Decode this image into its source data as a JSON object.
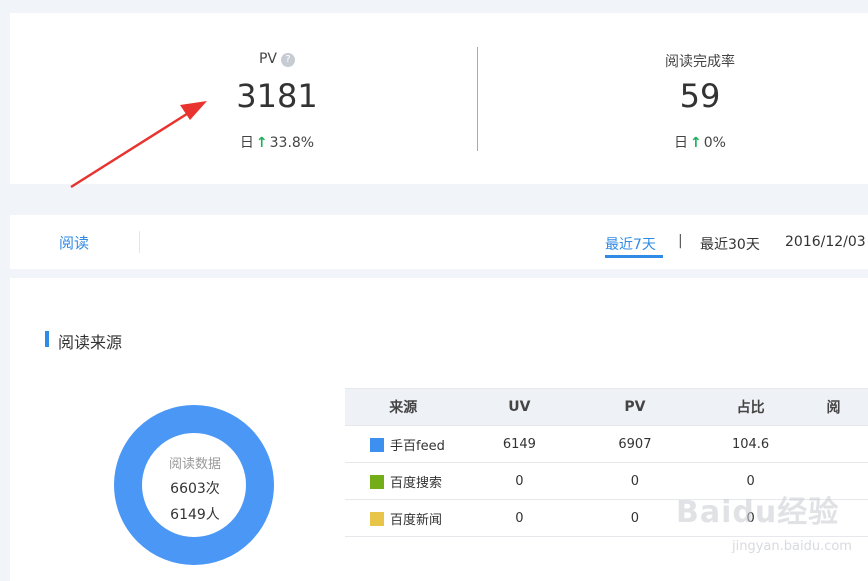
{
  "stats": [
    {
      "label": "PV",
      "value": "3181",
      "change_prefix": "日",
      "change": "33.8%",
      "help": "?"
    },
    {
      "label": "阅读完成率",
      "value": "59",
      "change_prefix": "日",
      "change": "0%"
    }
  ],
  "tabs": {
    "read": "阅读"
  },
  "range": {
    "last7": "最近7天",
    "sep": "|",
    "last30": "最近30天",
    "date": "2016/12/03 -"
  },
  "section": {
    "title": "阅读来源"
  },
  "donut": {
    "label": "阅读数据",
    "count": "6603次",
    "people": "6149人",
    "color": "#4a97f5"
  },
  "table": {
    "headers": [
      "来源",
      "UV",
      "PV",
      "占比",
      "阅"
    ],
    "rows": [
      {
        "source": "手百feed",
        "uv": "6149",
        "pv": "6907",
        "ratio": "104.6",
        "color": "#3d8ff0"
      },
      {
        "source": "百度搜索",
        "uv": "0",
        "pv": "0",
        "ratio": "0",
        "color": "#73ad17"
      },
      {
        "source": "百度新闻",
        "uv": "0",
        "pv": "0",
        "ratio": "0",
        "color": "#e8c548"
      }
    ]
  },
  "watermark": {
    "text": "Baidu经验",
    "url": "jingyan.baidu.com"
  },
  "colors": {
    "accent": "#2f8be6",
    "up": "#1bb15a",
    "annotation": "#e8332e"
  }
}
